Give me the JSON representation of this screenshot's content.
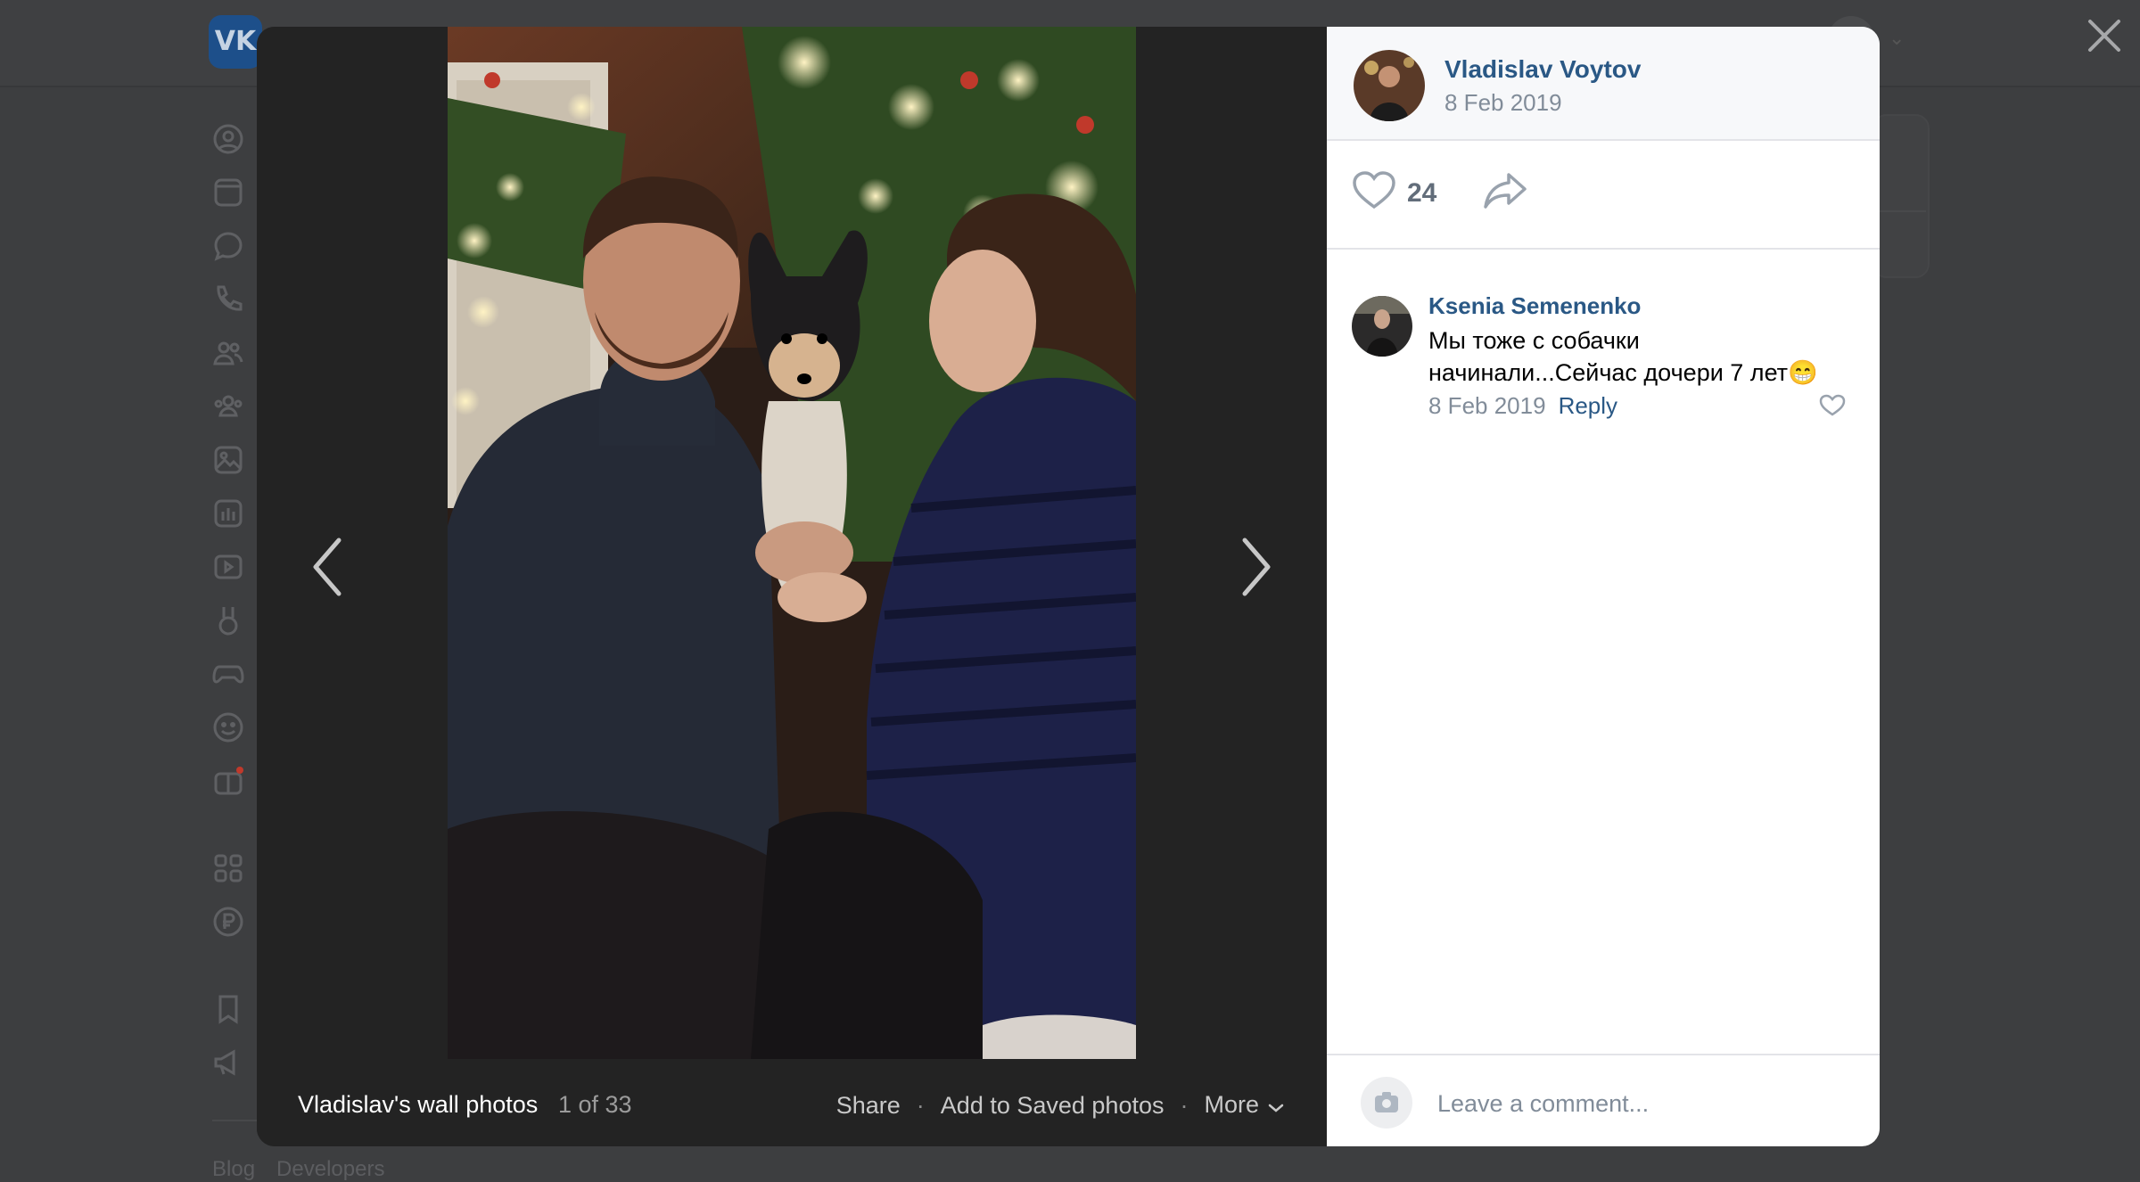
{
  "background": {
    "logo_text": "VK",
    "footer_links": [
      "Blog",
      "Developers"
    ],
    "sidebar_icons": [
      "profile-icon",
      "news-icon",
      "messages-icon",
      "calls-icon",
      "friends-icon",
      "communities-icon",
      "photos-icon",
      "music-icon",
      "video-icon",
      "clips-icon",
      "games-icon",
      "stickers-icon",
      "gifts-icon",
      "services-icon",
      "payments-icon",
      "bookmarks-icon",
      "ads-icon"
    ]
  },
  "viewer": {
    "album_title": "Vladislav's wall photos",
    "counter": "1 of 33",
    "actions": {
      "share": "Share",
      "save": "Add to Saved photos",
      "more": "More"
    },
    "post": {
      "author": "Vladislav Voytov",
      "date": "8 Feb 2019",
      "likes": "24"
    },
    "comments": [
      {
        "author": "Ksenia Semenenko",
        "text": "Мы тоже с собачки начинали...Сейчас дочери 7 лет😁",
        "date": "8 Feb 2019",
        "reply": "Reply"
      }
    ],
    "comment_placeholder": "Leave a comment..."
  },
  "colors": {
    "link": "#2a5885",
    "muted": "#818c99",
    "overlay": "#242424"
  }
}
